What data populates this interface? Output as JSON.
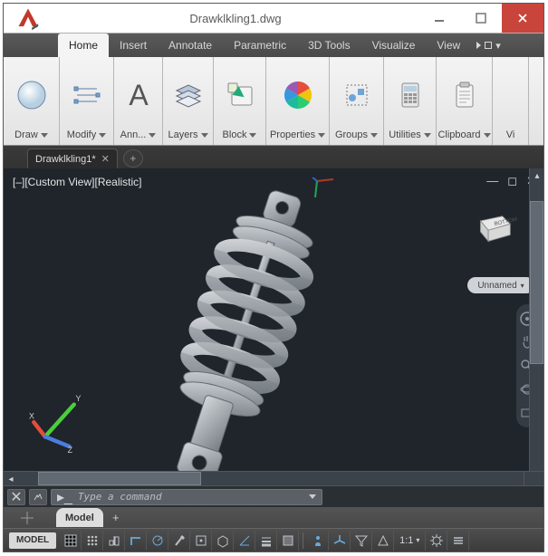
{
  "window": {
    "title": "Drawklkling1.dwg"
  },
  "menu": {
    "items": [
      "Home",
      "Insert",
      "Annotate",
      "Parametric",
      "3D Tools",
      "Visualize",
      "View"
    ],
    "active_index": 0
  },
  "ribbon": {
    "groups": [
      {
        "id": "draw",
        "label": "Draw",
        "icon": "circle-icon"
      },
      {
        "id": "modify",
        "label": "Modify",
        "icon": "modify-icon"
      },
      {
        "id": "ann",
        "label": "Ann...",
        "icon": "text-a-icon"
      },
      {
        "id": "layers",
        "label": "Layers",
        "icon": "layers-icon"
      },
      {
        "id": "block",
        "label": "Block",
        "icon": "block-insert-icon"
      },
      {
        "id": "properties",
        "label": "Properties",
        "icon": "color-wheel-icon"
      },
      {
        "id": "groups",
        "label": "Groups",
        "icon": "groups-icon"
      },
      {
        "id": "utilities",
        "label": "Utilities",
        "icon": "calculator-icon"
      },
      {
        "id": "clipboard",
        "label": "Clipboard",
        "icon": "clipboard-icon"
      },
      {
        "id": "vi",
        "label": "Vi",
        "icon": "overflow-icon"
      }
    ]
  },
  "document_tabs": {
    "items": [
      {
        "label": "Drawklkling1*"
      }
    ]
  },
  "viewport": {
    "view_label": "[–][Custom View][Realistic]",
    "viewcube_face": "BOTTOM",
    "unnamed_label": "Unnamed"
  },
  "command": {
    "placeholder": "Type a command"
  },
  "layout_tabs": {
    "active": "Model"
  },
  "status": {
    "model_btn": "MODEL",
    "scale": "1:1"
  }
}
